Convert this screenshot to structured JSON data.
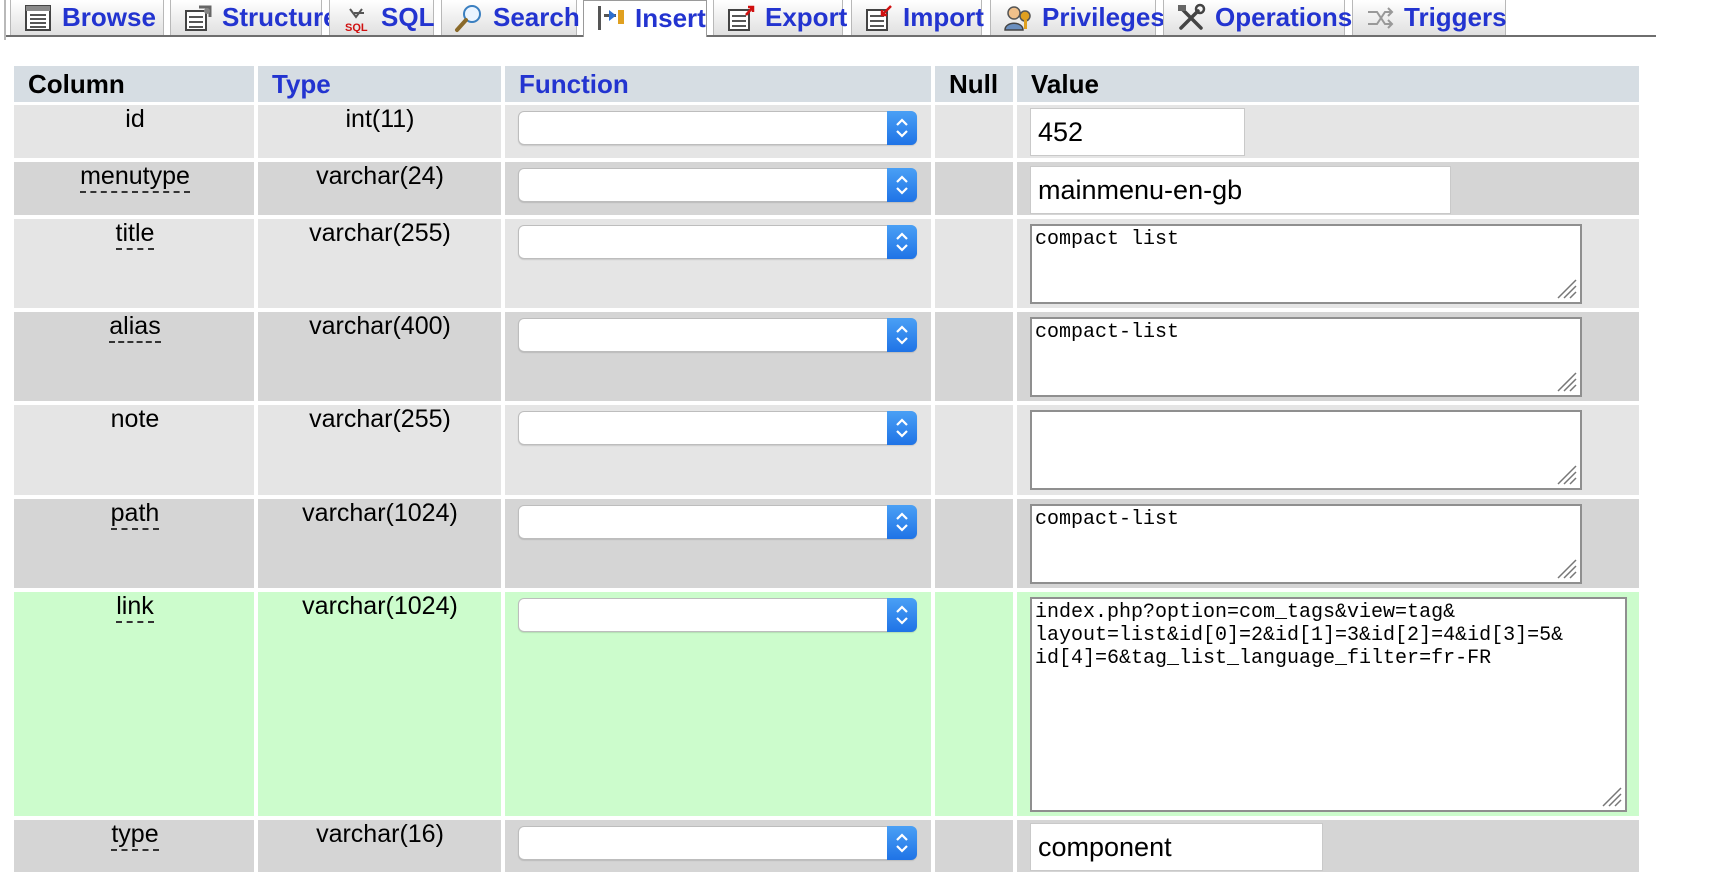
{
  "tabs": [
    {
      "label": "Browse",
      "icon": "browse-icon",
      "active": false
    },
    {
      "label": "Structure",
      "icon": "structure-icon",
      "active": false
    },
    {
      "label": "SQL",
      "icon": "sql-icon",
      "active": false
    },
    {
      "label": "Search",
      "icon": "search-icon",
      "active": false
    },
    {
      "label": "Insert",
      "icon": "insert-icon",
      "active": true
    },
    {
      "label": "Export",
      "icon": "export-icon",
      "active": false
    },
    {
      "label": "Import",
      "icon": "import-icon",
      "active": false
    },
    {
      "label": "Privileges",
      "icon": "privileges-icon",
      "active": false
    },
    {
      "label": "Operations",
      "icon": "operations-icon",
      "active": false
    },
    {
      "label": "Triggers",
      "icon": "triggers-icon",
      "active": false
    }
  ],
  "table": {
    "headers": {
      "column": "Column",
      "type": "Type",
      "function": "Function",
      "null": "Null",
      "value": "Value"
    },
    "rows": [
      {
        "column": "id",
        "type": "int(11)",
        "function": "",
        "value": "452",
        "value_kind": "input",
        "has_comment": false
      },
      {
        "column": "menutype",
        "type": "varchar(24)",
        "function": "",
        "value": "mainmenu-en-gb",
        "value_kind": "input",
        "has_comment": true
      },
      {
        "column": "title",
        "type": "varchar(255)",
        "function": "",
        "value": "compact list",
        "value_kind": "textarea",
        "has_comment": true
      },
      {
        "column": "alias",
        "type": "varchar(400)",
        "function": "",
        "value": "compact-list",
        "value_kind": "textarea",
        "has_comment": true
      },
      {
        "column": "note",
        "type": "varchar(255)",
        "function": "",
        "value": "",
        "value_kind": "textarea",
        "has_comment": false
      },
      {
        "column": "path",
        "type": "varchar(1024)",
        "function": "",
        "value": "compact-list",
        "value_kind": "textarea",
        "has_comment": true
      },
      {
        "column": "link",
        "type": "varchar(1024)",
        "function": "",
        "value": "index.php?option=com_tags&view=tag&\nlayout=list&id[0]=2&id[1]=3&id[2]=4&id[3]=5&\nid[4]=6&tag_list_language_filter=fr-FR",
        "value_kind": "textarea",
        "has_comment": true,
        "highlighted": true
      },
      {
        "column": "type",
        "type": "varchar(16)",
        "function": "",
        "value": "component",
        "value_kind": "input",
        "has_comment": true
      }
    ]
  },
  "colors": {
    "tab_text": "#2334d0",
    "header_bg": "#d6dde3",
    "row_light": "#e5e5e5",
    "row_dark": "#d5d5d5",
    "row_highlight": "#ccfccc",
    "select_button": "#1f73e6"
  }
}
